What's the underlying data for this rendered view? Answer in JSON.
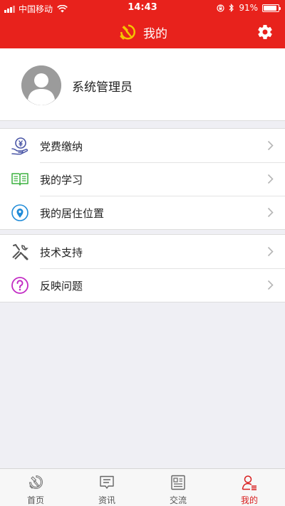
{
  "status_bar": {
    "carrier": "中国移动",
    "time": "14:43",
    "battery_text": "91%",
    "battery_level": 0.91
  },
  "header": {
    "title": "我的",
    "logo_icon": "party-emblem-icon",
    "settings_icon": "gear-icon"
  },
  "profile": {
    "name": "系统管理员",
    "avatar_icon": "default-avatar-icon"
  },
  "menu_groups": [
    {
      "items": [
        {
          "label": "党费缴纳",
          "icon": "yuan-payment-icon"
        },
        {
          "label": "我的学习",
          "icon": "book-icon"
        },
        {
          "label": "我的居住位置",
          "icon": "location-pin-icon"
        }
      ]
    },
    {
      "items": [
        {
          "label": "技术支持",
          "icon": "tools-icon"
        },
        {
          "label": "反映问题",
          "icon": "question-icon"
        }
      ]
    }
  ],
  "tab_bar": {
    "tabs": [
      {
        "label": "首页",
        "icon": "home-emblem-icon",
        "active": false
      },
      {
        "label": "资讯",
        "icon": "message-icon",
        "active": false
      },
      {
        "label": "交流",
        "icon": "news-icon",
        "active": false
      },
      {
        "label": "我的",
        "icon": "user-profile-icon",
        "active": true
      }
    ]
  },
  "colors": {
    "brand_red": "#e8221c",
    "active_tab": "#d81e1e",
    "page_bg": "#efeff4",
    "emblem_gold": "#f5c400"
  }
}
